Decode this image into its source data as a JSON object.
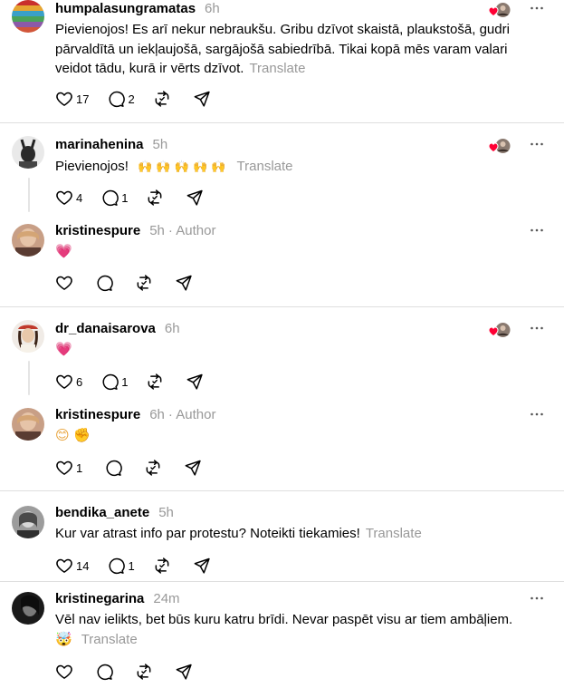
{
  "translate_label": "Translate",
  "posts": [
    {
      "username": "humpalasungramatas",
      "time": "6h",
      "text": "Pievienojos! Es arī nekur nebraukšu. Gribu dzīvot skaistā, plaukstošā, gudri pārvaldītā un iekļaujošā, sargājošā sabiedrībā. Tikai kopā mēs varam valari veidot tādu, kurā ir vērts dzīvot.",
      "likes": "17",
      "replies": "2"
    },
    {
      "username": "marinahenina",
      "time": "5h",
      "text": "Pievienojos!",
      "emojis": "🙌 🙌 🙌 🙌 🙌",
      "likes": "4",
      "replies": "1"
    },
    {
      "username": "kristinespure",
      "time": "5h",
      "author_label": "· Author",
      "emojis": "💗"
    },
    {
      "username": "dr_danaisarova",
      "time": "6h",
      "emojis": "💗",
      "likes": "6",
      "replies": "1"
    },
    {
      "username": "kristinespure",
      "time": "6h",
      "author_label": "· Author",
      "emojis": "😊 ✊",
      "likes": "1"
    },
    {
      "username": "bendika_anete",
      "time": "5h",
      "text": "Kur var atrast info par protestu? Noteikti tiekamies!",
      "likes": "14",
      "replies": "1"
    },
    {
      "username": "kristinegarina",
      "time": "24m",
      "text": "Vēl nav ielikts, bet būs kuru katru brīdi. Nevar paspēt visu ar tiem ambāļiem.",
      "emojis": "🤯"
    }
  ],
  "colors": {
    "like_heart": "#ff0034",
    "muted": "#999999",
    "divider": "#dfdfdf"
  },
  "icons": [
    "heart-icon",
    "comment-icon",
    "repost-icon",
    "share-icon",
    "more-icon"
  ]
}
